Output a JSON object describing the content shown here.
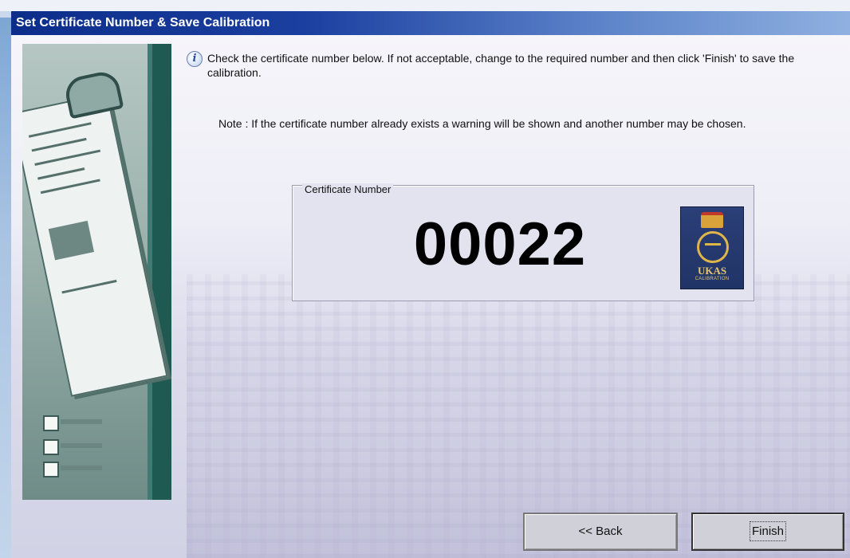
{
  "window": {
    "title": "Set Certificate Number & Save Calibration"
  },
  "instructions": {
    "message": "Check the certificate number below. If not acceptable, change to the required number and then click 'Finish' to save the calibration.",
    "note": "Note :  If the certificate number already exists a warning will be shown and another number may be chosen."
  },
  "certificate": {
    "legend": "Certificate Number",
    "number": "00022"
  },
  "badge": {
    "text": "UKAS",
    "subtext": "CALIBRATION"
  },
  "buttons": {
    "back_label": "<< Back",
    "finish_label": "Finish"
  },
  "colors": {
    "titlebar_start": "#0c2d8a",
    "titlebar_end": "#8fb0e0",
    "banner_green": "#1f5a52",
    "badge_blue": "#2b3f78",
    "badge_gold": "#e0b64a"
  },
  "icons": {
    "info": "info-icon",
    "banner": "clipboard-illustration"
  }
}
